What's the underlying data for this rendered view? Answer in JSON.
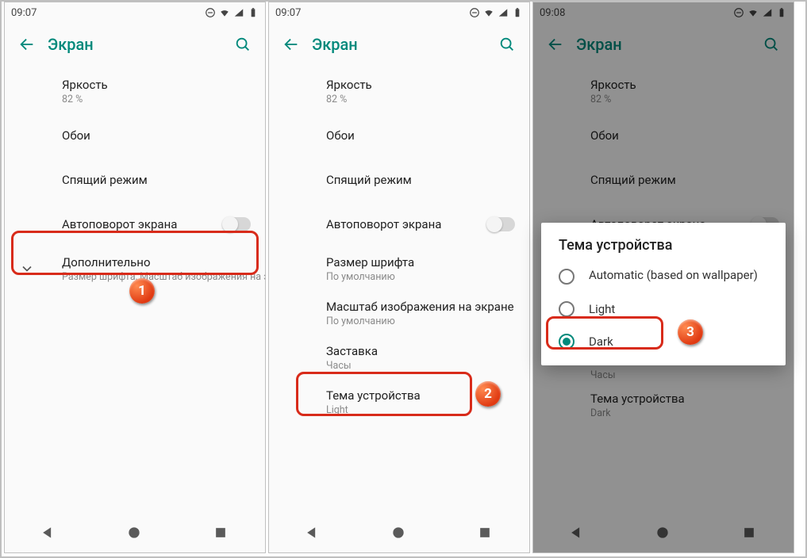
{
  "accent": "#00897b",
  "hl_color": "#d82b1a",
  "phone1": {
    "time": "09:07",
    "title": "Экран",
    "rows": {
      "brightness": {
        "t": "Яркость",
        "s": "82 %"
      },
      "wallpaper": {
        "t": "Обои"
      },
      "sleep": {
        "t": "Спящий режим"
      },
      "autorotate": {
        "t": "Автоповорот экрана"
      },
      "advanced": {
        "t": "Дополнительно",
        "s": "Размер шрифта, Масштаб изображения на э…"
      }
    },
    "badge": "1"
  },
  "phone2": {
    "time": "09:07",
    "title": "Экран",
    "rows": {
      "brightness": {
        "t": "Яркость",
        "s": "82 %"
      },
      "wallpaper": {
        "t": "Обои"
      },
      "sleep": {
        "t": "Спящий режим"
      },
      "autorotate": {
        "t": "Автоповорот экрана"
      },
      "fontsize": {
        "t": "Размер шрифта",
        "s": "По умолчанию"
      },
      "displaysize": {
        "t": "Масштаб изображения на экране",
        "s": "По умолчанию"
      },
      "screensaver": {
        "t": "Заставка",
        "s": "Часы"
      },
      "theme": {
        "t": "Тема устройства",
        "s": "Light"
      }
    },
    "badge": "2"
  },
  "phone3": {
    "time": "09:08",
    "title": "Экран",
    "rows": {
      "brightness": {
        "t": "Яркость",
        "s": "82 %"
      },
      "wallpaper": {
        "t": "Обои"
      },
      "sleep": {
        "t": "Спящий режим"
      },
      "autorotate": {
        "t": "Автоповорот экрана"
      },
      "screensaver": {
        "t": "Часы"
      },
      "theme": {
        "t": "Тема устройства",
        "s": "Dark"
      }
    },
    "dialog": {
      "title": "Тема устройства",
      "opt_auto": "Automatic (based on wallpaper)",
      "opt_light": "Light",
      "opt_dark": "Dark"
    },
    "badge": "3"
  }
}
